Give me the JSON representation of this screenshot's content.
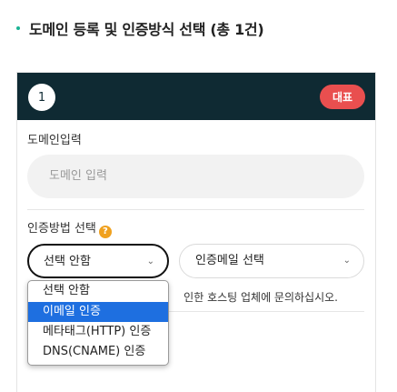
{
  "section": {
    "title": "도메인 등록 및 인증방식 선택 (총 1건)"
  },
  "card": {
    "number": "1",
    "badge": "대표",
    "domain_label": "도메인입력",
    "domain_placeholder": "도메인 입력",
    "method_label": "인증방법 선택",
    "help_icon_glyph": "?",
    "method_select": {
      "selected": "선택 안함",
      "options": [
        "선택 안함",
        "이메일 인증",
        "메타태그(HTTP) 인증",
        "DNS(CNAME) 인증"
      ],
      "highlighted": "이메일 인증"
    },
    "email_select": {
      "selected": "인증메일 선택"
    },
    "notice_fragment": "인한 호스팅 업체에 문의하십시오."
  },
  "colors": {
    "header_bg": "#0f2a33",
    "badge_bg": "#e94f4f",
    "help_icon": "#f0a11f",
    "highlight": "#1e6fe0",
    "title_dot": "#1ab394"
  }
}
